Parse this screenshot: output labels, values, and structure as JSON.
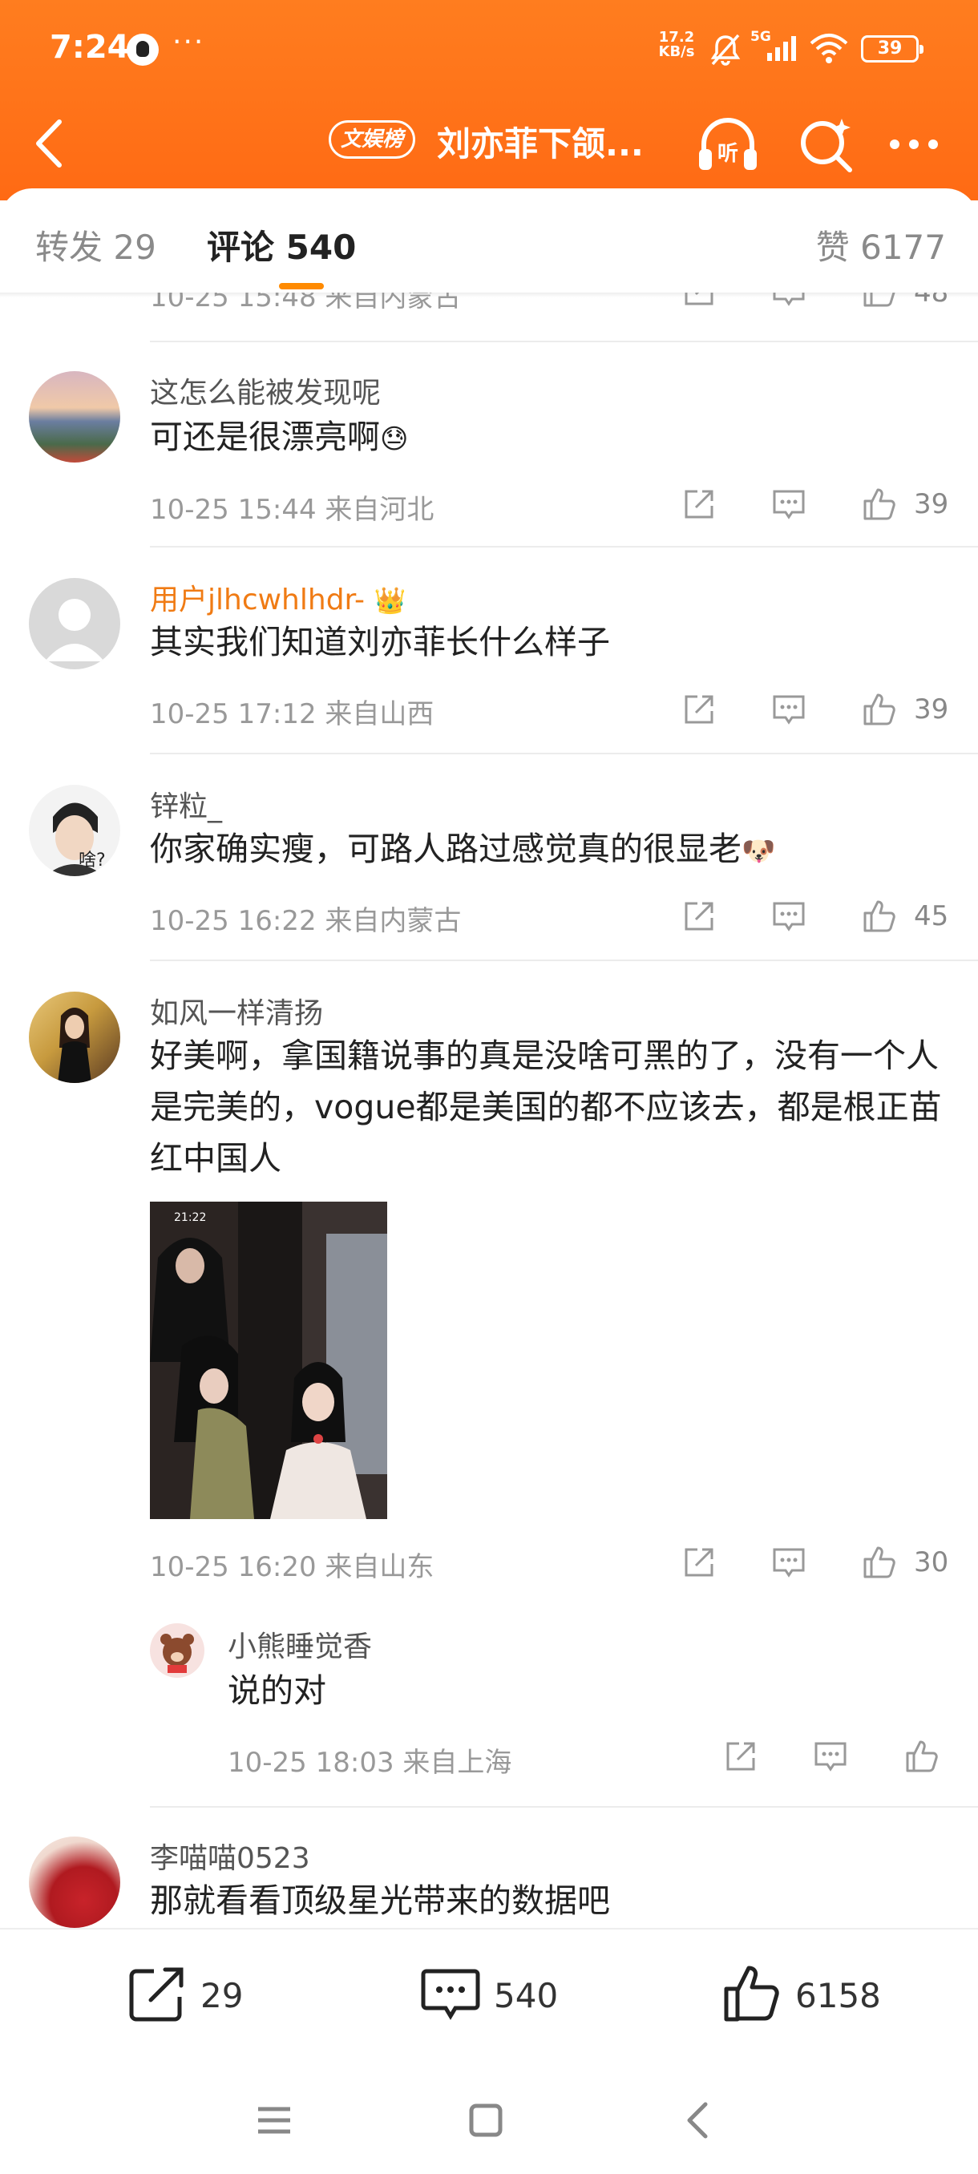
{
  "status": {
    "time": "7:24",
    "more": "···",
    "net_speed_1": "17.2",
    "net_speed_2": "KB/s",
    "signal": "5G",
    "battery": "39"
  },
  "header": {
    "tag": "文娱榜",
    "title": "刘亦菲下颌..."
  },
  "tabs": {
    "repost": "转发 29",
    "comments": "评论 540",
    "likes": "赞 6177"
  },
  "partial_row": {
    "meta": "10-25 15:48  来自内蒙古",
    "likes": "48"
  },
  "comments": [
    {
      "name": "这怎么能被发现呢",
      "text": "可还是很漂亮啊",
      "emoji": "😓",
      "meta": "10-25 15:44  来自河北",
      "likes": "39"
    },
    {
      "name": "用户jlhcwhlhdr-",
      "badge": "👑",
      "text": "其实我们知道刘亦菲长什么样子",
      "meta": "10-25 17:12  来自山西",
      "likes": "39"
    },
    {
      "name": "锌粒_",
      "avatar_text": "啥?",
      "text": "你家确实瘦，可路人路过感觉真的很显老",
      "emoji": "🐶",
      "meta": "10-25 16:22  来自内蒙古",
      "likes": "45"
    },
    {
      "name": "如风一样清扬",
      "text": "好美啊，拿国籍说事的真是没啥可黑的了，没有一个人是完美的，vogue都是美国的都不应该去，都是根正苗红中国人",
      "image_time": "21:22",
      "meta": "10-25 16:20  来自山东",
      "likes": "30"
    },
    {
      "name": "李喵喵0523",
      "text": "那就看看顶级星光带来的数据吧"
    }
  ],
  "reply": {
    "name": "小熊睡觉香",
    "text": "说的对",
    "meta": "10-25 18:03  来自上海"
  },
  "bottom_bar": {
    "repost": "29",
    "comment": "540",
    "like": "6158"
  }
}
